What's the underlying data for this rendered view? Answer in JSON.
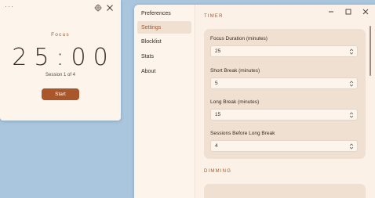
{
  "timer": {
    "menu_dots": "···",
    "mode_label": "Focus",
    "time": "25:00",
    "session": "Session 1 of 4",
    "start_label": "Start"
  },
  "sidebar": {
    "items": [
      {
        "label": "Preferences"
      },
      {
        "label": "Settings"
      },
      {
        "label": "Blocklist"
      },
      {
        "label": "Stats"
      },
      {
        "label": "About"
      }
    ],
    "active": "Settings"
  },
  "sections": {
    "timer_header": "TIMER",
    "dimming_header": "DIMMING"
  },
  "fields": [
    {
      "label": "Focus Duration (minutes)",
      "value": "25"
    },
    {
      "label": "Short Break (minutes)",
      "value": "5"
    },
    {
      "label": "Long Break (minutes)",
      "value": "15"
    },
    {
      "label": "Sessions Before Long Break",
      "value": "4"
    }
  ],
  "colors": {
    "accent": "#a8562a",
    "background": "#fdf4ec",
    "card": "#efe0d2",
    "desktop": "#a9c6de"
  }
}
